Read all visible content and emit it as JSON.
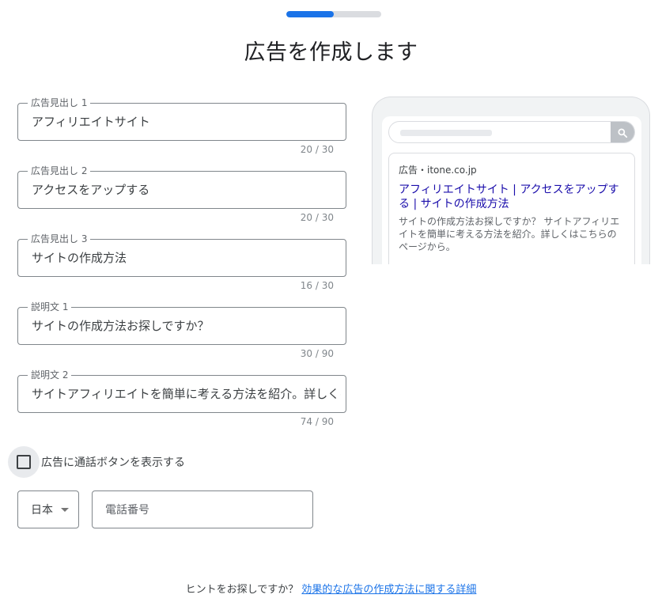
{
  "progress": {
    "fraction": 0.5
  },
  "page_title": "広告を作成します",
  "fields": [
    {
      "label": "広告見出し 1",
      "value": "アフィリエイトサイト",
      "counter": "20 / 30"
    },
    {
      "label": "広告見出し 2",
      "value": "アクセスをアップする",
      "counter": "20 / 30"
    },
    {
      "label": "広告見出し 3",
      "value": "サイトの作成方法",
      "counter": "16 / 30"
    },
    {
      "label": "説明文 1",
      "value": "サイトの作成方法お探しですか？",
      "counter": "30 / 90"
    },
    {
      "label": "説明文 2",
      "value": "サイトアフィリエイトを簡単に考える方法を紹介。詳しくはこちらのページから。",
      "counter": "74 / 90"
    }
  ],
  "call_option": {
    "label": "広告に通話ボタンを表示する",
    "checked": false
  },
  "country": {
    "value": "日本"
  },
  "phone": {
    "placeholder": "電話番号"
  },
  "footer": {
    "text": "ヒントをお探しですか？",
    "link": "効果的な広告の作成方法に関する詳細"
  },
  "preview": {
    "ad_label": "広告・itone.co.jp",
    "headline": "アフィリエイトサイト | アクセスをアップする | サイトの作成方法",
    "description": "サイトの作成方法お探しですか？ サイトアフィリエイトを簡単に考える方法を紹介。詳しくはこちらのページから。"
  },
  "colors": {
    "accent": "#1a73e8",
    "ad_headline": "#1a0dab"
  },
  "icons": {
    "search": "search-icon",
    "dropdown": "caret-down-icon"
  }
}
